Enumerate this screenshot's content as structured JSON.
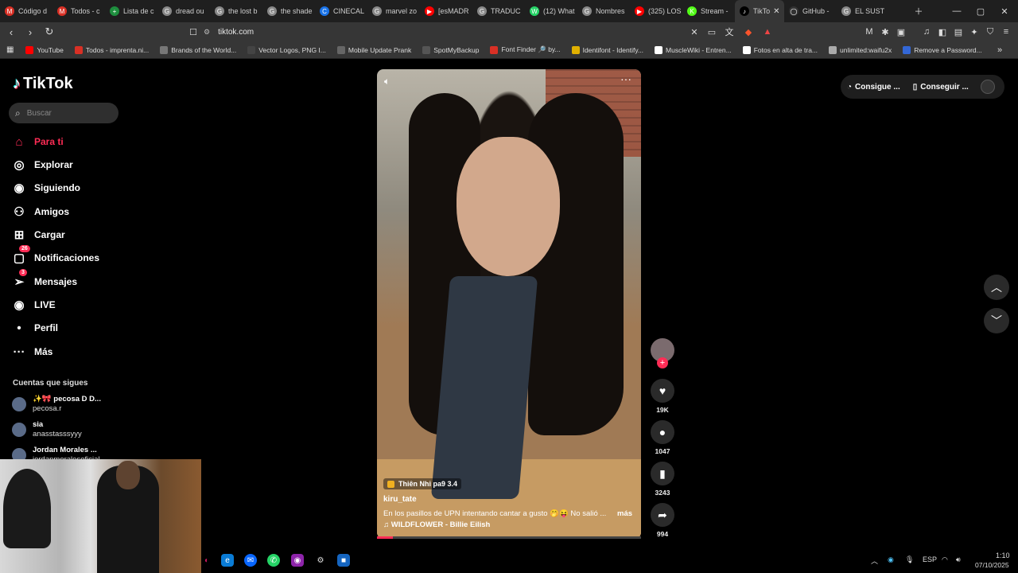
{
  "browser": {
    "tabs": [
      {
        "label": "Código d",
        "color": "#d93025",
        "glyph": "M"
      },
      {
        "label": "Todos - c",
        "color": "#d93025",
        "glyph": "M"
      },
      {
        "label": "Lista de c",
        "color": "#1e8e3e",
        "glyph": "+"
      },
      {
        "label": "dread ou",
        "color": "#888888",
        "glyph": "G"
      },
      {
        "label": "the lost b",
        "color": "#888888",
        "glyph": "G"
      },
      {
        "label": "the shade",
        "color": "#888888",
        "glyph": "G"
      },
      {
        "label": "CINECAL",
        "color": "#1a73e8",
        "glyph": "C"
      },
      {
        "label": "marvel zo",
        "color": "#888888",
        "glyph": "G"
      },
      {
        "label": "[esMADR",
        "color": "#ff0000",
        "glyph": "▶"
      },
      {
        "label": "TRADUC",
        "color": "#888888",
        "glyph": "G"
      },
      {
        "label": "(12) What",
        "color": "#25d366",
        "glyph": "W"
      },
      {
        "label": "Nombres",
        "color": "#888888",
        "glyph": "G"
      },
      {
        "label": "(325) LOS",
        "color": "#ff0000",
        "glyph": "▶"
      },
      {
        "label": "Stream -",
        "color": "#53fc18",
        "glyph": "K"
      },
      {
        "label": "TikTo",
        "color": "#000000",
        "glyph": "♪",
        "active": true
      },
      {
        "label": "GitHub -",
        "color": "#333333",
        "glyph": "◯"
      },
      {
        "label": "EL SUST",
        "color": "#888888",
        "glyph": "G"
      }
    ],
    "url": "tiktok.com",
    "bookmarks": [
      {
        "label": "YouTube",
        "color": "#ff0000"
      },
      {
        "label": "Todos - imprenta.ni...",
        "color": "#d93025"
      },
      {
        "label": "Brands of the World...",
        "color": "#777777"
      },
      {
        "label": "Vector Logos, PNG I...",
        "color": "#444444"
      },
      {
        "label": "Mobile Update Prank",
        "color": "#666666"
      },
      {
        "label": "SpotMyBackup",
        "color": "#555555"
      },
      {
        "label": "Font Finder 🔎 by...",
        "color": "#d93025"
      },
      {
        "label": "Identifont - Identify...",
        "color": "#e0b000"
      },
      {
        "label": "MuscleWiki - Entren...",
        "color": "#ffffff"
      },
      {
        "label": "Fotos en alta de tra...",
        "color": "#ffffff"
      },
      {
        "label": "unlimited:waifu2x",
        "color": "#aaaaaa"
      },
      {
        "label": "Remove a Password...",
        "color": "#3367d6"
      }
    ]
  },
  "tiktok": {
    "logo": "TikTok",
    "search_placeholder": "Buscar",
    "nav": [
      {
        "label": "Para ti",
        "icon": "home-icon",
        "active": true
      },
      {
        "label": "Explorar",
        "icon": "compass-icon"
      },
      {
        "label": "Siguiendo",
        "icon": "following-icon"
      },
      {
        "label": "Amigos",
        "icon": "friends-icon"
      },
      {
        "label": "Cargar",
        "icon": "upload-icon"
      },
      {
        "label": "Notificaciones",
        "icon": "inbox-icon",
        "badge": "26"
      },
      {
        "label": "Mensajes",
        "icon": "messages-icon",
        "badge": "3"
      },
      {
        "label": "LIVE",
        "icon": "live-icon"
      },
      {
        "label": "Perfil",
        "icon": "profile-icon"
      },
      {
        "label": "Más",
        "icon": "more-icon"
      }
    ],
    "following_heading": "Cuentas que sigues",
    "following": [
      {
        "name": "✨🎀 pecosa D D...",
        "handle": "pecosa.r"
      },
      {
        "name": "sia",
        "handle": "anasstasssyyy"
      },
      {
        "name": "Jordan Morales ...",
        "handle": "jordanmoralesoficial"
      }
    ],
    "video": {
      "tag": "Thiên Nhi pa9 3.4",
      "username": "kiru_tate",
      "description": "En los pasillos de UPN intentando cantar a gusto 🤭😝 No salió ...",
      "more": "más",
      "music": "♫ WILDFLOWER - Billie Eilish",
      "progress": 0.06
    },
    "actions": {
      "likes": "19K",
      "comments": "1047",
      "saves": "3243",
      "shares": "994"
    },
    "top_right": {
      "btn1": "Consigue ...",
      "btn2": "Conseguir ..."
    }
  },
  "taskbar": {
    "lang": "ESP",
    "time": "1:10",
    "date": "07/10/2025"
  }
}
